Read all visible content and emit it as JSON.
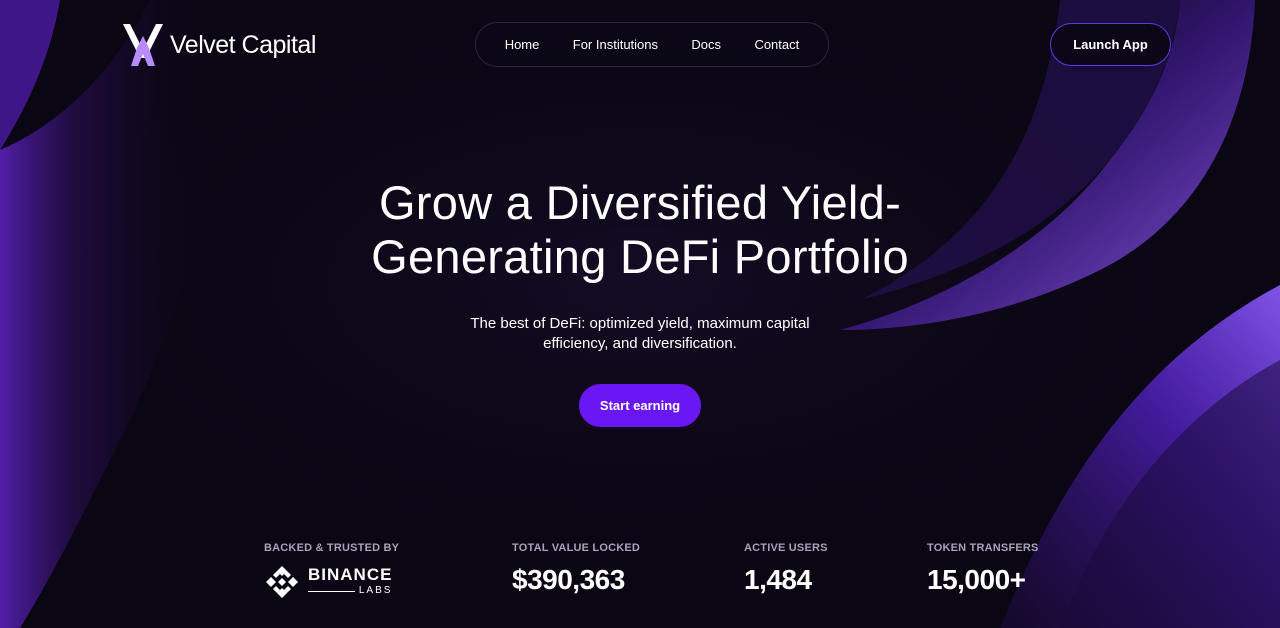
{
  "header": {
    "brand": "Velvet Capital",
    "nav": [
      {
        "label": "Home"
      },
      {
        "label": "For Institutions"
      },
      {
        "label": "Docs"
      },
      {
        "label": "Contact"
      }
    ],
    "launch_label": "Launch App"
  },
  "hero": {
    "title_line1": "Grow a Diversified Yield-",
    "title_line2": "Generating DeFi Portfolio",
    "subtitle": "The best of DeFi: optimized yield, maximum capital efficiency, and diversification.",
    "cta_label": "Start earning"
  },
  "stats": {
    "backed_label": "BACKED & TRUSTED BY",
    "backer_name": "BINANCE",
    "backer_sub": "LABS",
    "tvl_label": "TOTAL VALUE LOCKED",
    "tvl_value": "$390,363",
    "users_label": "ACTIVE USERS",
    "users_value": "1,484",
    "transfers_label": "TOKEN TRANSFERS",
    "transfers_value": "15,000+"
  },
  "colors": {
    "background": "#0b0614",
    "accent": "#6b16f5",
    "glow": "#7b3cff",
    "muted_text": "#a8a3b8"
  },
  "icons": {
    "brand": "velvet-capital-logo-icon",
    "backer": "binance-logo-icon"
  }
}
